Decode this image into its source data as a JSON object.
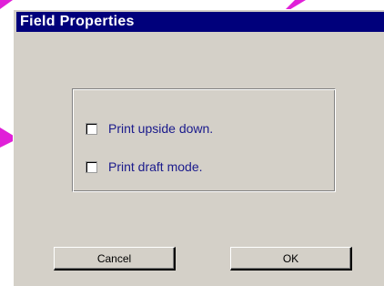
{
  "dialog": {
    "title": "Field Properties"
  },
  "options": [
    {
      "label": "Print upside down.",
      "checked": false
    },
    {
      "label": "Print draft mode.",
      "checked": false
    }
  ],
  "buttons": {
    "cancel_label": "Cancel",
    "ok_label": "OK"
  },
  "colors": {
    "title_bar": "#00007b",
    "dialog_face": "#d4d0c8",
    "callout": "#e020d8",
    "label_text": "#1a1a8c"
  }
}
